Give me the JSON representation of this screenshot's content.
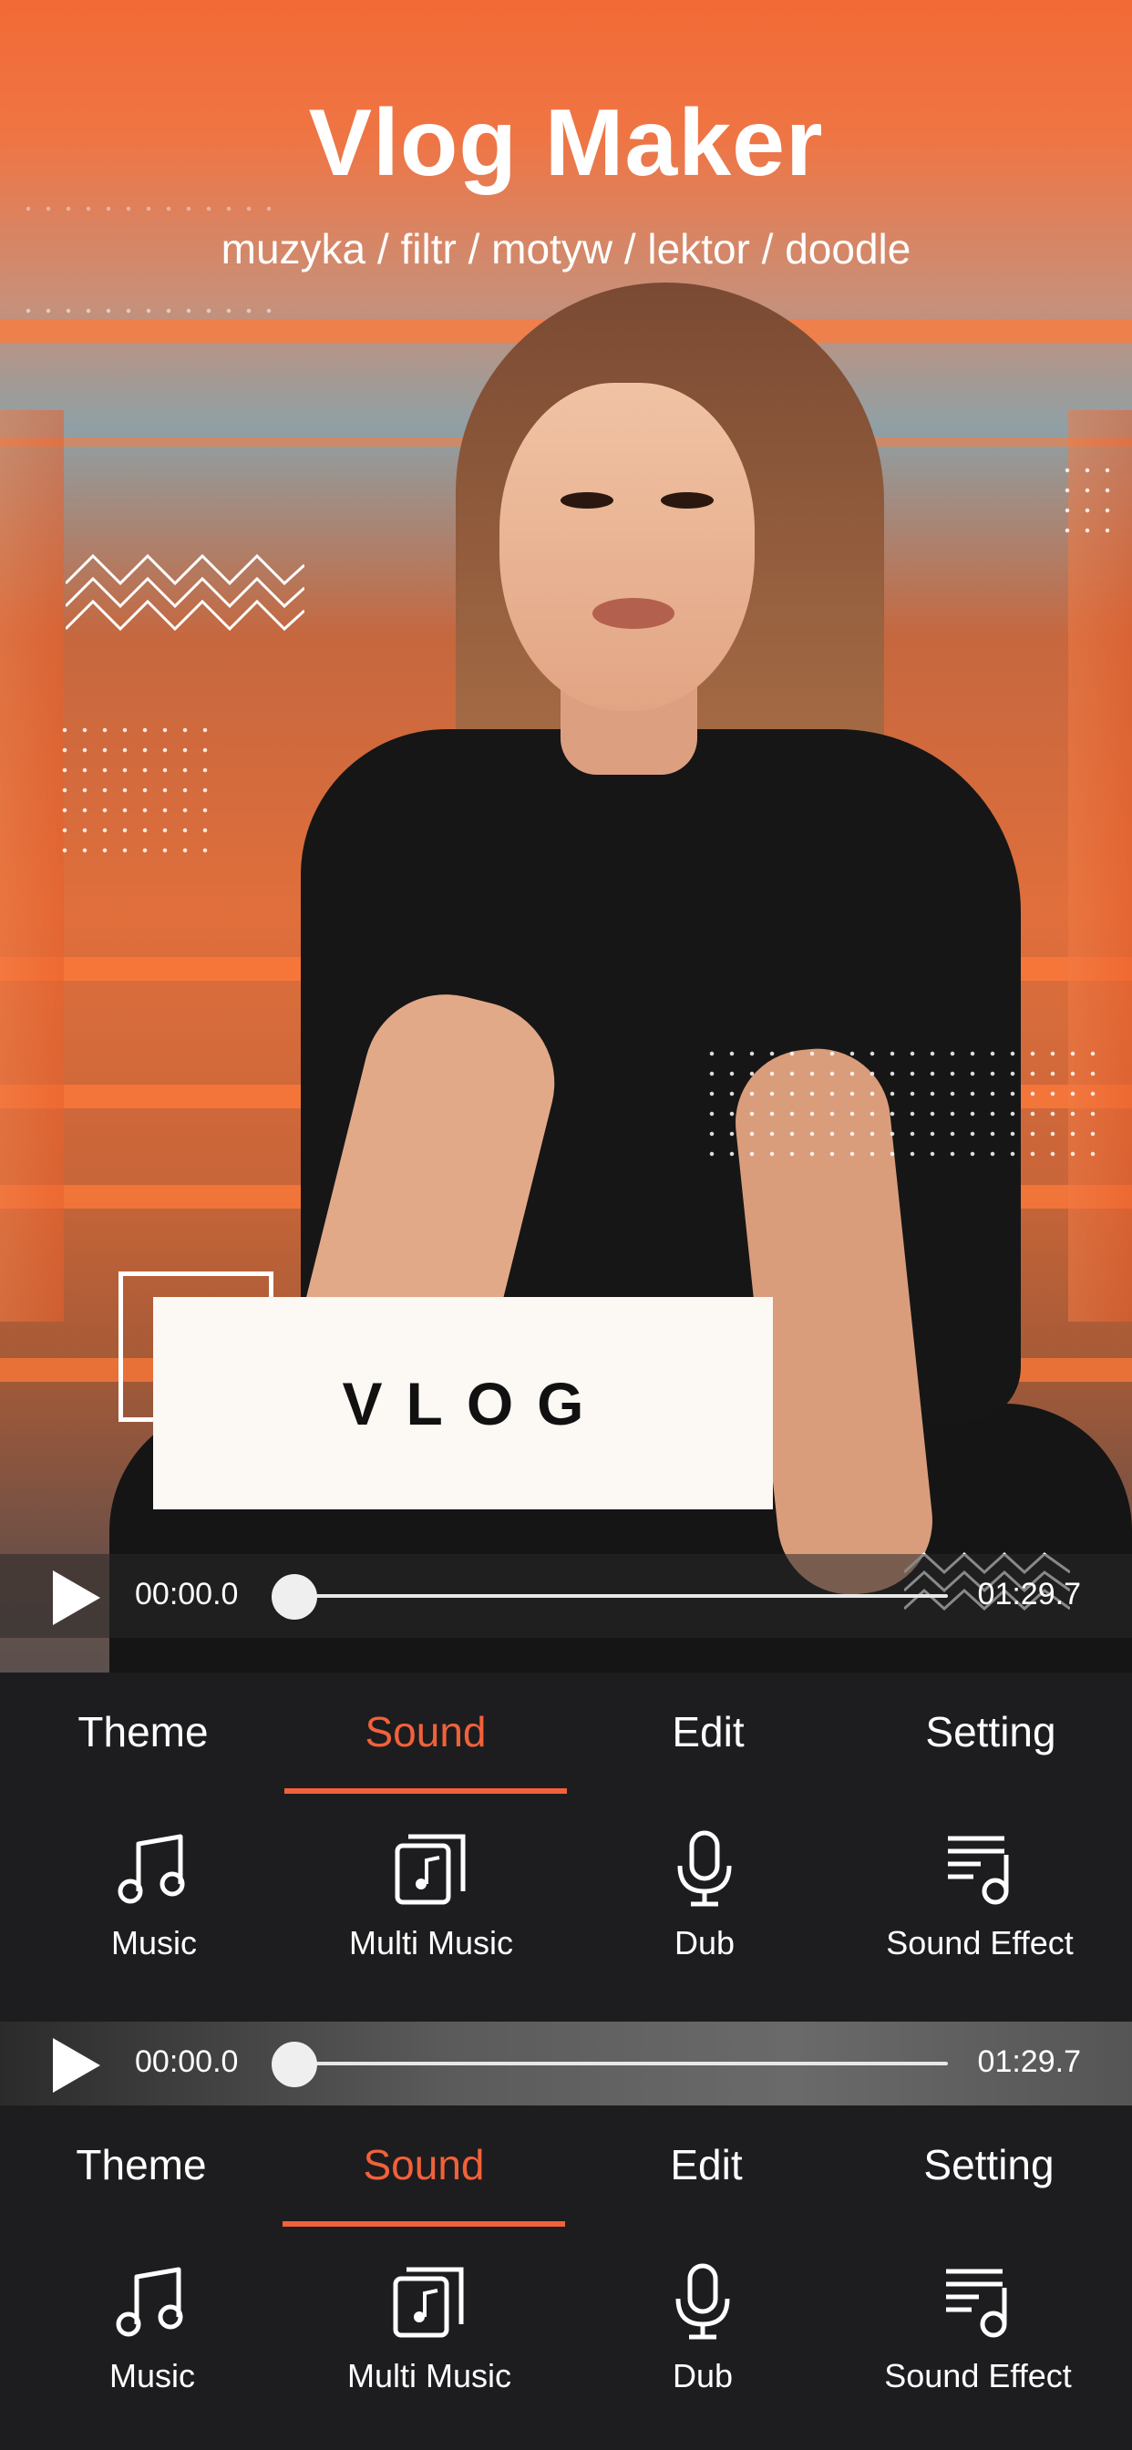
{
  "header": {
    "title": "Vlog Maker",
    "subtitle": "muzyka / filtr / motyw / lektor / doodle"
  },
  "card": {
    "text": "VLOG"
  },
  "player": {
    "start_time": "00:00.0",
    "end_time": "01:29.7",
    "progress": 0
  },
  "tabs": [
    {
      "label": "Theme",
      "active": false
    },
    {
      "label": "Sound",
      "active": true
    },
    {
      "label": "Edit",
      "active": false
    },
    {
      "label": "Setting",
      "active": false
    }
  ],
  "tools": [
    {
      "label": "Music",
      "icon": "music-note-icon"
    },
    {
      "label": "Multi Music",
      "icon": "multi-music-icon"
    },
    {
      "label": "Dub",
      "icon": "microphone-icon"
    },
    {
      "label": "Sound Effect",
      "icon": "sound-effect-icon"
    }
  ],
  "colors": {
    "accent": "#f2613a",
    "panel_background": "#1d1d1f",
    "hero_orange": "#f26a36"
  }
}
